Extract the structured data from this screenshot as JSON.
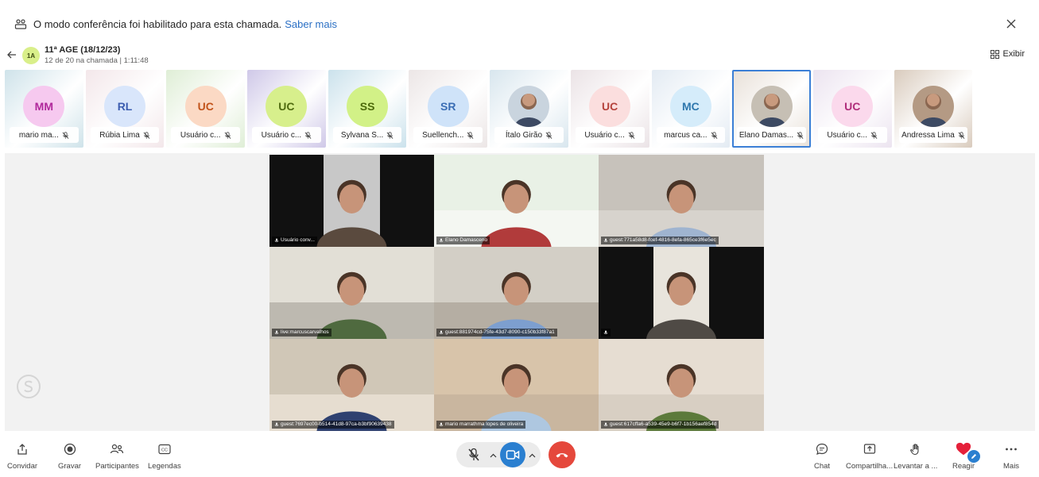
{
  "notice": {
    "text": "O modo conferência foi habilitado para esta chamada.",
    "link": "Saber mais",
    "icon": "conference-icon",
    "close_icon": "close-icon"
  },
  "header": {
    "group_badge": "1A",
    "title": "11ª AGE (18/12/23)",
    "subtitle": "12 de 20 na chamada | 1:11:48",
    "view_label": "Exibir"
  },
  "participants": [
    {
      "initials": "MM",
      "name": "mario ma...",
      "avatar_color": "#f6c9ef",
      "text_color": "#b0279b",
      "bg": "#cfe3ea"
    },
    {
      "initials": "RL",
      "name": "Rúbia Lima",
      "avatar_color": "#d9e6fb",
      "text_color": "#3c5db0",
      "bg": "#f3e7ea"
    },
    {
      "initials": "UC",
      "name": "Usuário c...",
      "avatar_color": "#fbd9c4",
      "text_color": "#c2531a",
      "bg": "#dfeed6"
    },
    {
      "initials": "UC",
      "name": "Usuário c...",
      "avatar_color": "#d7ef8c",
      "text_color": "#4f6b0f",
      "bg": "#cfc8e8"
    },
    {
      "initials": "SS",
      "name": "Sylvana S...",
      "avatar_color": "#d2f187",
      "text_color": "#4c6a0a",
      "bg": "#cbe2ec"
    },
    {
      "initials": "SR",
      "name": "Suellench...",
      "avatar_color": "#cfe3f9",
      "text_color": "#3a6db4",
      "bg": "#ece6e6"
    },
    {
      "initials": "",
      "name": "Ítalo Girão",
      "avatar_color": "#c9d4de",
      "text_color": "#333333",
      "bg": "#d8e6ee",
      "photo": true
    },
    {
      "initials": "UC",
      "name": "Usuário c...",
      "avatar_color": "#fbdede",
      "text_color": "#b5423c",
      "bg": "#ebe3e6"
    },
    {
      "initials": "MC",
      "name": "marcus ca...",
      "avatar_color": "#d5ecfa",
      "text_color": "#2e77ad",
      "bg": "#e3ebf3"
    },
    {
      "initials": "",
      "name": "Elano Damas...",
      "avatar_color": "#c6bfb4",
      "text_color": "#333333",
      "bg": "#e8e0d8",
      "photo": true,
      "selected": true
    },
    {
      "initials": "UC",
      "name": "Usuário c...",
      "avatar_color": "#fbd9ec",
      "text_color": "#b02d7a",
      "bg": "#ece4f0"
    },
    {
      "initials": "",
      "name": "Andressa Lima",
      "avatar_color": "#b49a84",
      "text_color": "#333333",
      "bg": "#d9cbbd",
      "photo": true
    }
  ],
  "videos": [
    {
      "label": "Usuário conv...",
      "bg": "#111111",
      "scene": "#c8c8c8",
      "person": "#5a4a3e"
    },
    {
      "label": "Elano Damasceno",
      "bg": "#f4f7f2",
      "scene": "#e9f1e6",
      "person": "#b13b3b"
    },
    {
      "label": "guest:771a58d8-fcef-4816-8efa-865ce3f6e5ec",
      "bg": "#d7d3cd",
      "scene": "#c7c2bb",
      "person": "#9fb4d0"
    },
    {
      "label": "live:marcuscarvalhos",
      "bg": "#bdb9b0",
      "scene": "#e2dfd6",
      "person": "#4f6a3f"
    },
    {
      "label": "guest:881974cd-75fe-43d7-8090-c150b33f87a1",
      "bg": "#b5aea3",
      "scene": "#d3cfc6",
      "person": "#7d9fcf"
    },
    {
      "label": "",
      "bg": "#111111",
      "scene": "#e8e4dc",
      "person": "#4f4a45"
    },
    {
      "label": "guest:7697ec00-b514-41d8-97ca-b3bf90639438",
      "bg": "#e6ddd0",
      "scene": "#d0c7b7",
      "person": "#2f4170"
    },
    {
      "label": "mario marrathma lopes de oliveira",
      "bg": "#c9b69f",
      "scene": "#d8c4aa",
      "person": "#aec7e0"
    },
    {
      "label": "guest:617cffa6-a539-45e9-b6f7-1b156aef854d",
      "bg": "#d8cfc3",
      "scene": "#e6ddd2",
      "person": "#5c7a3b"
    }
  ],
  "toolbar": {
    "invite": "Convidar",
    "record": "Gravar",
    "participants": "Participantes",
    "captions": "Legendas",
    "chat": "Chat",
    "share": "Compartilha...",
    "raise_hand": "Levantar a ...",
    "react": "Reagir",
    "more": "Mais"
  },
  "colors": {
    "accent": "#2a6fc4",
    "video_button": "#2a7fd0",
    "hangup": "#e5483c",
    "reaction_heart": "#e5203a"
  }
}
